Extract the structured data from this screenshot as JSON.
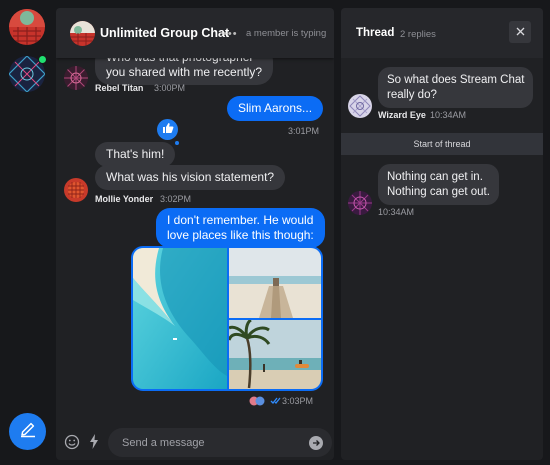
{
  "rail": {
    "compose_icon": "pencil-icon",
    "online_color": "#20e070"
  },
  "chat": {
    "title": "Unlimited Group Chat",
    "typing_dots": "•••",
    "typing_text": "a member is typing",
    "messages": {
      "m1_line1": "Who was that photographer",
      "m1_line2": "you shared with me recently?",
      "m1_author": "Rebel Titan",
      "m1_time": "3:00PM",
      "m2_text": "Slim Aarons...",
      "m2_time": "3:01PM",
      "m3_text": "That's him!",
      "m4_text": "What was his vision statement?",
      "m4_author": "Mollie Yonder",
      "m4_time": "3:02PM",
      "m5_line1": "I don't remember. He would",
      "m5_line2": "love places like this though:",
      "m5_time": "3:03PM"
    },
    "reaction_icon": "thumbs-up-icon",
    "composer_placeholder": "Send a message",
    "accent": "#0b6cf5"
  },
  "thread": {
    "title": "Thread",
    "reply_count": "2 replies",
    "parent_line1": "So what does Stream Chat",
    "parent_line2": "really do?",
    "parent_author": "Wizard Eye",
    "parent_time": "10:34AM",
    "start_label": "Start of thread",
    "reply_line1": "Nothing can get in.",
    "reply_line2": "Nothing can get out.",
    "reply_time": "10:34AM"
  }
}
